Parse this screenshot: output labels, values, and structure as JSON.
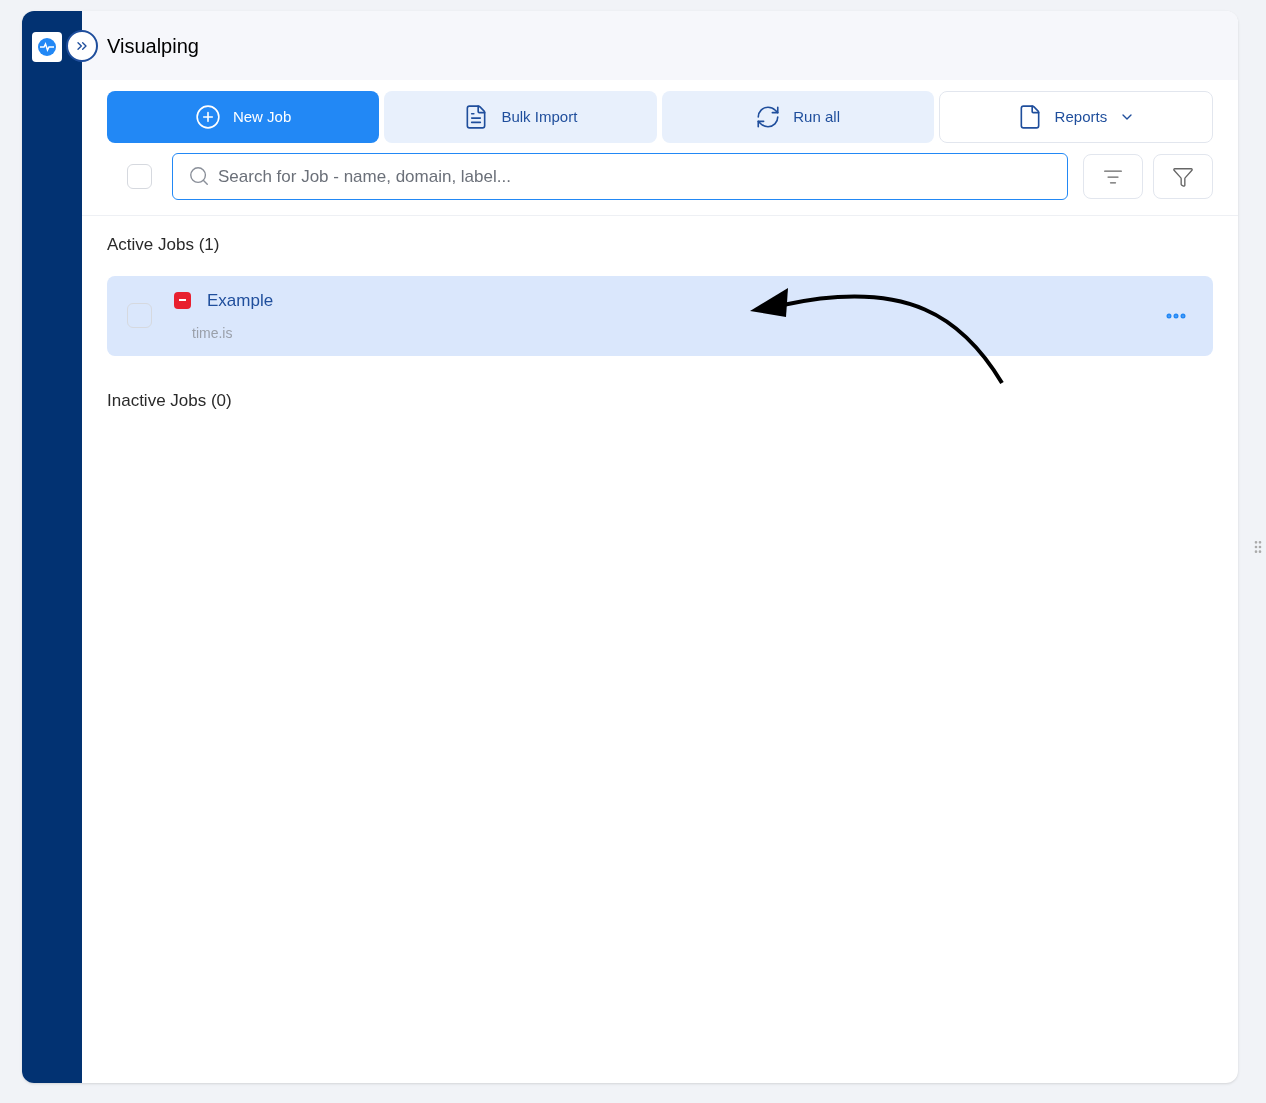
{
  "header": {
    "title": "Visualping"
  },
  "toolbar": [
    {
      "kind": "primary",
      "label": "New Job"
    },
    {
      "kind": "secondary",
      "label": "Bulk Import"
    },
    {
      "kind": "secondary",
      "label": "Run all"
    },
    {
      "kind": "dropdown",
      "label": "Reports"
    }
  ],
  "search": {
    "placeholder": "Search for Job - name, domain, label...",
    "select_all_checked": false
  },
  "sections": [
    {
      "title": "Active Jobs (1)",
      "jobs": [
        {
          "name": "Example",
          "domain": "time.is",
          "selected": true,
          "checked": false
        }
      ]
    },
    {
      "title": "Inactive Jobs (0)"
    }
  ]
}
